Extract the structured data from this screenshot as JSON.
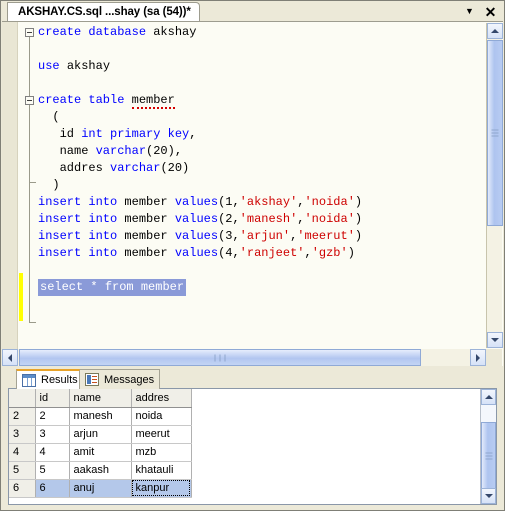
{
  "window": {
    "document_tab_title": "AKSHAY.CS.sql ...shay (sa (54))*",
    "dropdown_icon": "chevron-down-icon",
    "close_icon": "close-icon",
    "close_label": "✕",
    "dropdown_label": "▼"
  },
  "editor": {
    "lines": [
      {
        "fold": "open",
        "segments": [
          {
            "t": "create database ",
            "c": "kw"
          },
          {
            "t": "akshay",
            "c": "pl"
          }
        ]
      },
      {
        "fold": "none",
        "segments": []
      },
      {
        "fold": "none",
        "segments": [
          {
            "t": "use ",
            "c": "kw"
          },
          {
            "t": "akshay",
            "c": "pl"
          }
        ]
      },
      {
        "fold": "none",
        "segments": []
      },
      {
        "fold": "open",
        "segments": [
          {
            "t": "create table ",
            "c": "kw"
          },
          {
            "t": "member",
            "c": "pl squiggle"
          }
        ]
      },
      {
        "fold": "none",
        "segments": [
          {
            "t": "  (",
            "c": "pl"
          }
        ]
      },
      {
        "fold": "none",
        "segments": [
          {
            "t": "   id ",
            "c": "pl"
          },
          {
            "t": "int primary key",
            "c": "kw"
          },
          {
            "t": ",",
            "c": "pl"
          }
        ]
      },
      {
        "fold": "none",
        "segments": [
          {
            "t": "   name ",
            "c": "pl"
          },
          {
            "t": "varchar",
            "c": "kw"
          },
          {
            "t": "(20),",
            "c": "pl"
          }
        ]
      },
      {
        "fold": "none",
        "segments": [
          {
            "t": "   addres ",
            "c": "pl"
          },
          {
            "t": "varchar",
            "c": "kw"
          },
          {
            "t": "(20)",
            "c": "pl"
          }
        ]
      },
      {
        "fold": "foot",
        "segments": [
          {
            "t": "  )",
            "c": "pl"
          }
        ]
      },
      {
        "fold": "none",
        "segments": [
          {
            "t": "insert into ",
            "c": "kw"
          },
          {
            "t": "member ",
            "c": "pl"
          },
          {
            "t": "values",
            "c": "kw"
          },
          {
            "t": "(1,",
            "c": "pl"
          },
          {
            "t": "'akshay'",
            "c": "str"
          },
          {
            "t": ",",
            "c": "pl"
          },
          {
            "t": "'noida'",
            "c": "str"
          },
          {
            "t": ")",
            "c": "pl"
          }
        ]
      },
      {
        "fold": "none",
        "segments": [
          {
            "t": "insert into ",
            "c": "kw"
          },
          {
            "t": "member ",
            "c": "pl"
          },
          {
            "t": "values",
            "c": "kw"
          },
          {
            "t": "(2,",
            "c": "pl"
          },
          {
            "t": "'manesh'",
            "c": "str"
          },
          {
            "t": ",",
            "c": "pl"
          },
          {
            "t": "'noida'",
            "c": "str"
          },
          {
            "t": ")",
            "c": "pl"
          }
        ]
      },
      {
        "fold": "none",
        "segments": [
          {
            "t": "insert into ",
            "c": "kw"
          },
          {
            "t": "member ",
            "c": "pl"
          },
          {
            "t": "values",
            "c": "kw"
          },
          {
            "t": "(3,",
            "c": "pl"
          },
          {
            "t": "'arjun'",
            "c": "str"
          },
          {
            "t": ",",
            "c": "pl"
          },
          {
            "t": "'meerut'",
            "c": "str"
          },
          {
            "t": ")",
            "c": "pl"
          }
        ]
      },
      {
        "fold": "none",
        "segments": [
          {
            "t": "insert into ",
            "c": "kw"
          },
          {
            "t": "member ",
            "c": "pl"
          },
          {
            "t": "values",
            "c": "kw"
          },
          {
            "t": "(4,",
            "c": "pl"
          },
          {
            "t": "'ranjeet'",
            "c": "str"
          },
          {
            "t": ",",
            "c": "pl"
          },
          {
            "t": "'gzb'",
            "c": "str"
          },
          {
            "t": ")",
            "c": "pl"
          }
        ]
      },
      {
        "fold": "none",
        "segments": []
      },
      {
        "fold": "none",
        "selected": true,
        "segments": [
          {
            "t": "select ",
            "c": "kw"
          },
          {
            "t": "* ",
            "c": "pl"
          },
          {
            "t": "from ",
            "c": "kw"
          },
          {
            "t": "member",
            "c": "pl"
          }
        ]
      }
    ]
  },
  "results": {
    "tabs": [
      {
        "label": "Results",
        "icon": "results-grid-icon",
        "active": true
      },
      {
        "label": "Messages",
        "icon": "messages-icon",
        "active": false
      }
    ],
    "grid": {
      "columns": [
        "id",
        "name",
        "addres"
      ],
      "rows": [
        {
          "header": "2",
          "cells": [
            "2",
            "manesh",
            "noida"
          ],
          "selected": false
        },
        {
          "header": "3",
          "cells": [
            "3",
            "arjun",
            "meerut"
          ],
          "selected": false
        },
        {
          "header": "4",
          "cells": [
            "4",
            "amit",
            "mzb"
          ],
          "selected": false
        },
        {
          "header": "5",
          "cells": [
            "5",
            "aakash",
            "khatauli"
          ],
          "selected": false
        },
        {
          "header": "6",
          "cells": [
            "6",
            "anuj",
            "kanpur"
          ],
          "selected": true,
          "focus_cell_index": 2
        }
      ]
    }
  },
  "colors": {
    "keyword": "#0000ff",
    "string": "#ce0000",
    "selection": "#8a9ad8",
    "change_bar": "#ffff00",
    "grid_selection": "#b4c8ea",
    "active_tab_accent": "#e8a32a",
    "chrome": "#ece9d8"
  }
}
